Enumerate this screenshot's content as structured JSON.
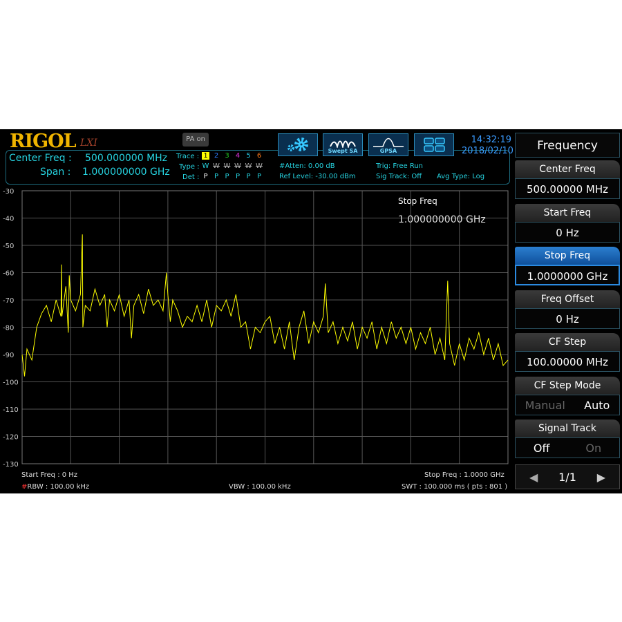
{
  "header": {
    "logo": "RIGOL",
    "lxi": "LXI",
    "pa": "PA on",
    "center_label": "Center Freq :",
    "center_value": "500.000000 MHz",
    "span_label": "Span :",
    "span_value": "1.000000000 GHz",
    "trace_label": "Trace :",
    "type_label": "Type :",
    "det_label": "Det :",
    "traces": [
      {
        "n": "1",
        "color": "#000",
        "type": "W",
        "det": "P"
      },
      {
        "n": "2",
        "color": "#2b7fff",
        "type": "W",
        "det": "P"
      },
      {
        "n": "3",
        "color": "#22cc22",
        "type": "W",
        "det": "P"
      },
      {
        "n": "4",
        "color": "#dd33dd",
        "type": "W",
        "det": "P"
      },
      {
        "n": "5",
        "color": "#26c6e0",
        "type": "W",
        "det": "P"
      },
      {
        "n": "6",
        "color": "#ff7a1a",
        "type": "W",
        "det": "P"
      }
    ],
    "atten": "#Atten: 0.00 dB",
    "ref_level": "Ref Level: -30.00 dBm",
    "trig": "Trig: Free Run",
    "sig_track": "Sig Track: Off",
    "avg_type": "Avg Type: Log",
    "mode_buttons": [
      "Swept SA",
      "GPSA"
    ],
    "time": "14:32:19",
    "date": "2018/02/10"
  },
  "plot": {
    "marker_label": "Stop Freq",
    "marker_value": "1.000000000 GHz"
  },
  "footer": {
    "start": "Start Freq : 0 Hz",
    "stop": "Stop Freq : 1.0000 GHz",
    "rbw_hash": "#",
    "rbw": "RBW : 100.00 kHz",
    "vbw": "VBW : 100.00 kHz",
    "swt": "SWT : 100.000 ms ( pts : 801 )"
  },
  "menu": {
    "title": "Frequency",
    "keys": [
      {
        "label": "Center Freq",
        "value": "500.00000 MHz"
      },
      {
        "label": "Start Freq",
        "value": "0 Hz"
      },
      {
        "label": "Stop Freq",
        "value": "1.0000000 GHz",
        "selected": true
      },
      {
        "label": "Freq Offset",
        "value": "0 Hz"
      },
      {
        "label": "CF Step",
        "value": "100.00000 MHz"
      },
      {
        "label": "CF Step Mode",
        "options": [
          "Manual",
          "Auto"
        ],
        "active": "Auto"
      },
      {
        "label": "Signal Track",
        "options": [
          "Off",
          "On"
        ],
        "active": "Off"
      }
    ],
    "page": "1/1"
  },
  "chart_data": {
    "type": "line",
    "xlim": [
      0,
      1000
    ],
    "xunit": "MHz",
    "ylim": [
      -130,
      -30
    ],
    "yunit": "dBm",
    "grid": true,
    "trace_color": "#ffff00",
    "yticks": [
      -30,
      -40,
      -50,
      -60,
      -70,
      -80,
      -90,
      -100,
      -110,
      -120,
      -130
    ],
    "x": [
      0,
      5,
      10,
      20,
      30,
      40,
      50,
      60,
      70,
      80,
      81,
      82,
      90,
      95,
      97,
      100,
      110,
      120,
      124,
      125,
      130,
      140,
      150,
      160,
      170,
      175,
      180,
      190,
      200,
      210,
      220,
      225,
      230,
      240,
      250,
      260,
      270,
      280,
      290,
      297,
      300,
      305,
      310,
      320,
      330,
      340,
      350,
      360,
      370,
      380,
      390,
      400,
      410,
      420,
      430,
      440,
      450,
      460,
      470,
      480,
      490,
      500,
      510,
      520,
      530,
      540,
      550,
      560,
      570,
      580,
      590,
      600,
      610,
      620,
      624,
      630,
      640,
      650,
      660,
      670,
      680,
      690,
      700,
      710,
      720,
      730,
      740,
      750,
      760,
      770,
      780,
      790,
      800,
      810,
      820,
      830,
      840,
      850,
      860,
      870,
      876,
      880,
      890,
      900,
      910,
      920,
      930,
      940,
      950,
      960,
      970,
      980,
      990,
      1000
    ],
    "y": [
      -90,
      -98,
      -88,
      -92,
      -80,
      -75,
      -72,
      -78,
      -70,
      -76,
      -57,
      -76,
      -65,
      -82,
      -61,
      -70,
      -74,
      -68,
      -46,
      -80,
      -72,
      -74,
      -66,
      -72,
      -68,
      -80,
      -70,
      -74,
      -68,
      -76,
      -70,
      -84,
      -72,
      -68,
      -75,
      -66,
      -72,
      -70,
      -74,
      -60,
      -68,
      -78,
      -70,
      -74,
      -80,
      -76,
      -78,
      -72,
      -78,
      -70,
      -80,
      -72,
      -74,
      -70,
      -76,
      -68,
      -80,
      -78,
      -88,
      -80,
      -82,
      -78,
      -76,
      -86,
      -80,
      -88,
      -78,
      -92,
      -80,
      -74,
      -86,
      -78,
      -82,
      -76,
      -64,
      -82,
      -78,
      -86,
      -80,
      -85,
      -78,
      -88,
      -80,
      -84,
      -78,
      -88,
      -80,
      -86,
      -78,
      -84,
      -80,
      -86,
      -80,
      -88,
      -82,
      -86,
      -80,
      -90,
      -84,
      -92,
      -63,
      -86,
      -94,
      -86,
      -92,
      -84,
      -88,
      -82,
      -90,
      -84,
      -92,
      -86,
      -94,
      -92
    ]
  }
}
